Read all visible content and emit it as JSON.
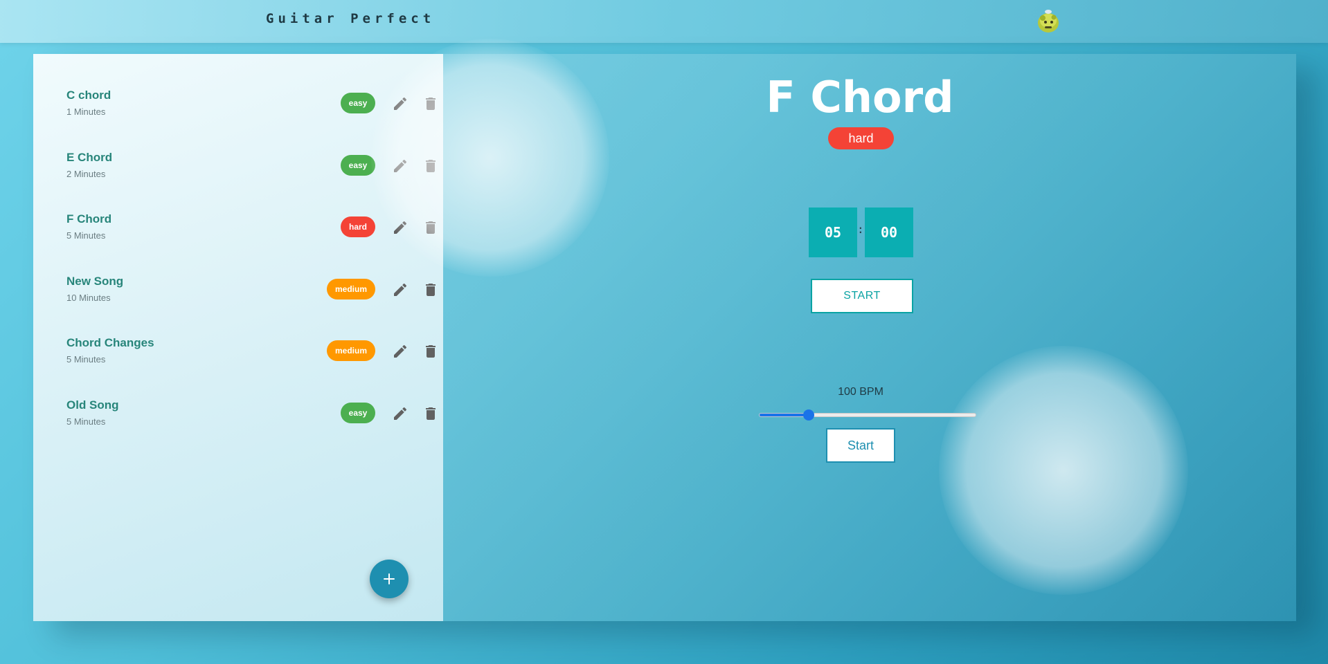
{
  "header": {
    "app_title": "Guitar Perfect",
    "avatar_icon": "creature-avatar-icon"
  },
  "sidebar": {
    "exercises": [
      {
        "name": "C chord",
        "duration": "1 Minutes",
        "level": "easy"
      },
      {
        "name": "E Chord",
        "duration": "2 Minutes",
        "level": "easy"
      },
      {
        "name": "F Chord",
        "duration": "5 Minutes",
        "level": "hard"
      },
      {
        "name": "New Song",
        "duration": "10 Minutes",
        "level": "medium"
      },
      {
        "name": "Chord Changes",
        "duration": "5 Minutes",
        "level": "medium"
      },
      {
        "name": "Old Song",
        "duration": "5 Minutes",
        "level": "easy"
      }
    ],
    "add_button_label": "+"
  },
  "main": {
    "title": "F Chord",
    "level": "hard",
    "timer": {
      "minutes": "05",
      "separator": ":",
      "seconds": "00",
      "start_label": "START"
    },
    "metronome": {
      "bpm_label": "100 BPM",
      "bpm_value": 100,
      "bpm_fill_fraction": 0.23,
      "start_label": "Start"
    }
  },
  "colors": {
    "easy": "#4caf50",
    "medium": "#ff9800",
    "hard": "#f44336",
    "accent": "#0baeb2",
    "primary": "#1e8fb0"
  }
}
